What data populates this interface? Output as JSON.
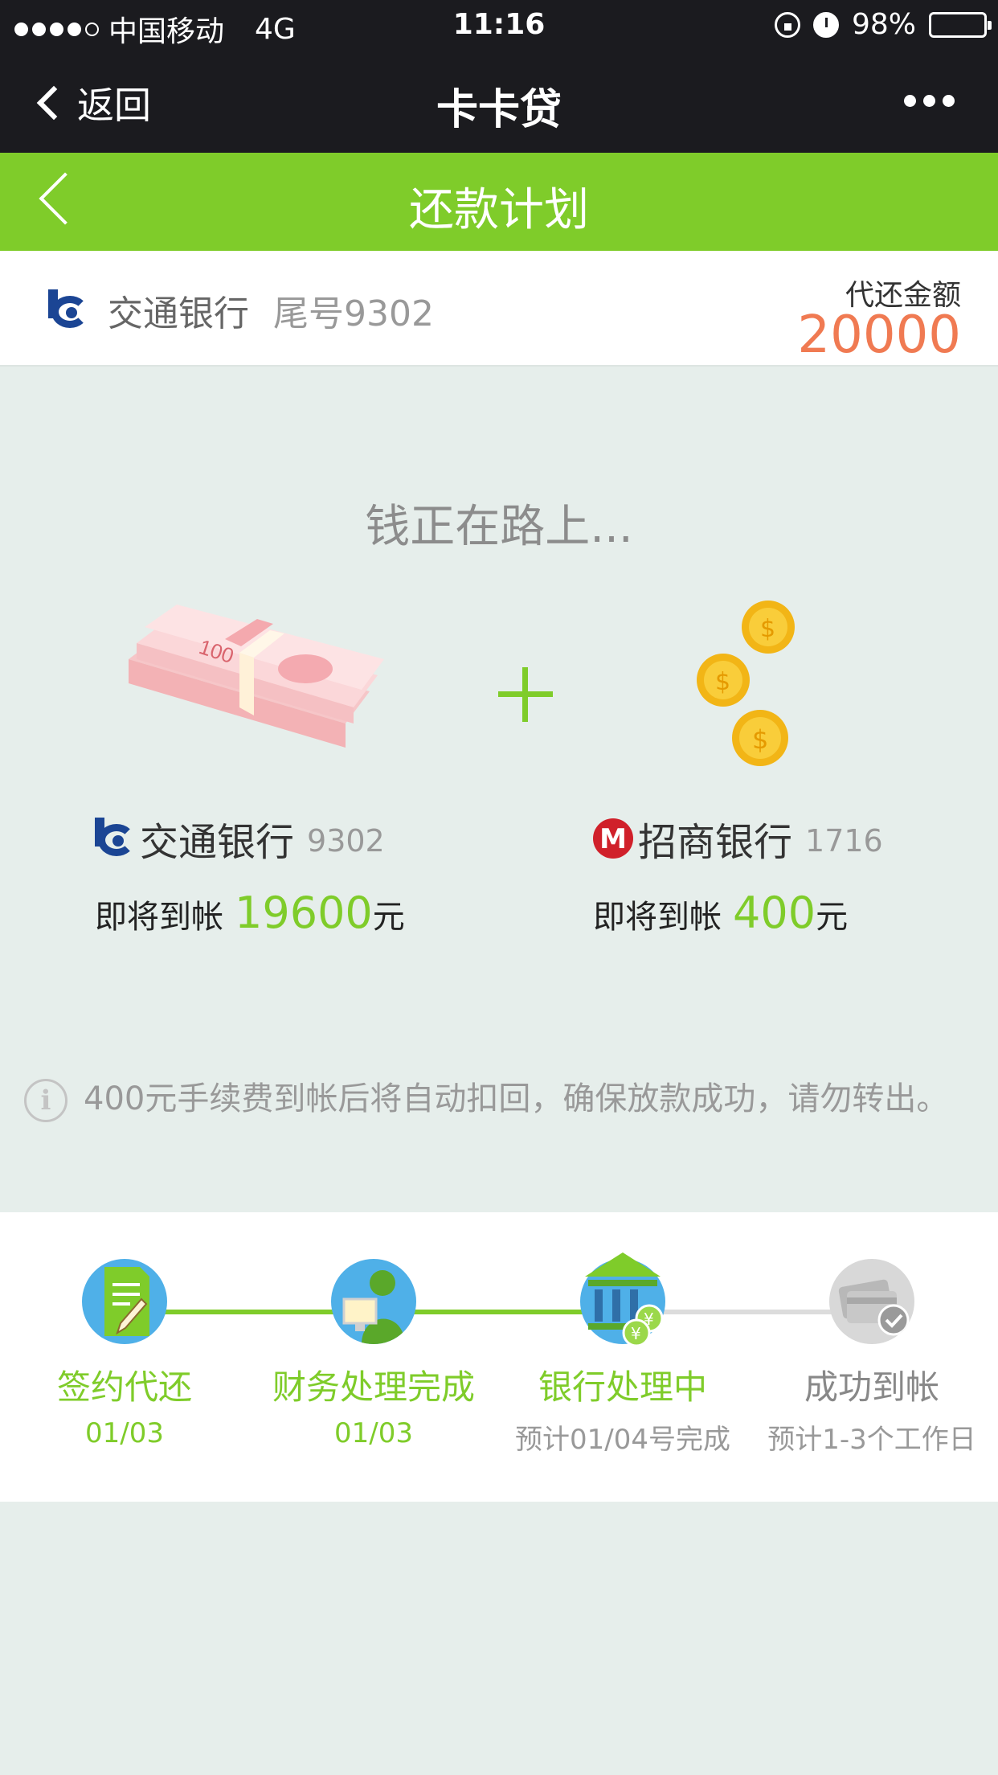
{
  "status_bar": {
    "carrier": "中国移动",
    "network": "4G",
    "time": "11:16",
    "battery": "98%",
    "battery_level": 0.98
  },
  "nav": {
    "back_label": "返回",
    "title": "卡卡贷"
  },
  "header": {
    "title": "还款计划"
  },
  "account": {
    "bank_name": "交通银行",
    "tail_number": "尾号9302",
    "amount_label": "代还金额",
    "amount": "20000"
  },
  "transfer": {
    "heading": "钱正在路上...",
    "left": {
      "bank": "交通银行",
      "card_no": "9302",
      "label": "即将到帐",
      "amount": "19600",
      "unit": "元"
    },
    "right": {
      "bank": "招商银行",
      "card_no": "1716",
      "label": "即将到帐",
      "amount": "400",
      "unit": "元"
    }
  },
  "notice": {
    "text": "400元手续费到帐后将自动扣回，确保放款成功，请勿转出。"
  },
  "steps": [
    {
      "name": "签约代还",
      "sub": "01/03",
      "state": "done"
    },
    {
      "name": "财务处理完成",
      "sub": "01/03",
      "state": "done"
    },
    {
      "name": "银行处理中",
      "sub": "预计01/04号完成",
      "state": "current"
    },
    {
      "name": "成功到帐",
      "sub": "预计1-3个工作日",
      "state": "pending"
    }
  ],
  "colors": {
    "accent_green": "#7fcc2a",
    "amount_orange": "#f07a52",
    "dark_bar": "#1b1b1f",
    "background": "#e6eeeb"
  }
}
